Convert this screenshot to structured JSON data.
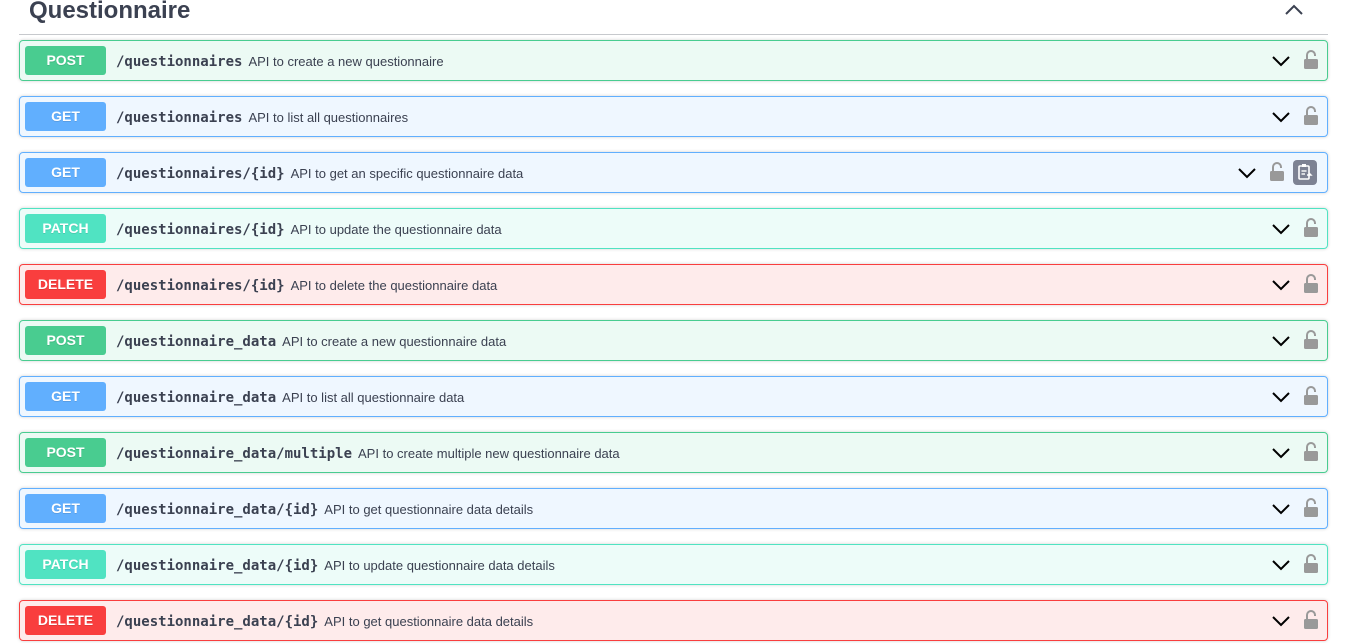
{
  "section": {
    "title": "Questionnaire",
    "toggle_icon": "chevron-up-icon"
  },
  "colors": {
    "post": "#49cc90",
    "get": "#61affe",
    "patch": "#50e3c2",
    "delete": "#f93e3e"
  },
  "operations": [
    {
      "method": "POST",
      "kind": "post",
      "path": "/questionnaires",
      "summary": "API to create a new questionnaire"
    },
    {
      "method": "GET",
      "kind": "get",
      "path": "/questionnaires",
      "summary": "API to list all questionnaires"
    },
    {
      "method": "GET",
      "kind": "get",
      "path": "/questionnaires/{id}",
      "summary": "API to get an specific questionnaire data",
      "copy_icon": true
    },
    {
      "method": "PATCH",
      "kind": "patch",
      "path": "/questionnaires/{id}",
      "summary": "API to update the questionnaire data"
    },
    {
      "method": "DELETE",
      "kind": "delete",
      "path": "/questionnaires/{id}",
      "summary": "API to delete the questionnaire data"
    },
    {
      "method": "POST",
      "kind": "post",
      "path": "/questionnaire_data",
      "summary": "API to create a new questionnaire data"
    },
    {
      "method": "GET",
      "kind": "get",
      "path": "/questionnaire_data",
      "summary": "API to list all questionnaire data"
    },
    {
      "method": "POST",
      "kind": "post",
      "path": "/questionnaire_data/multiple",
      "summary": "API to create multiple new questionnaire data"
    },
    {
      "method": "GET",
      "kind": "get",
      "path": "/questionnaire_data/{id}",
      "summary": "API to get questionnaire data details"
    },
    {
      "method": "PATCH",
      "kind": "patch",
      "path": "/questionnaire_data/{id}",
      "summary": "API to update questionnaire data details"
    },
    {
      "method": "DELETE",
      "kind": "delete",
      "path": "/questionnaire_data/{id}",
      "summary": "API to get questionnaire data details"
    }
  ]
}
